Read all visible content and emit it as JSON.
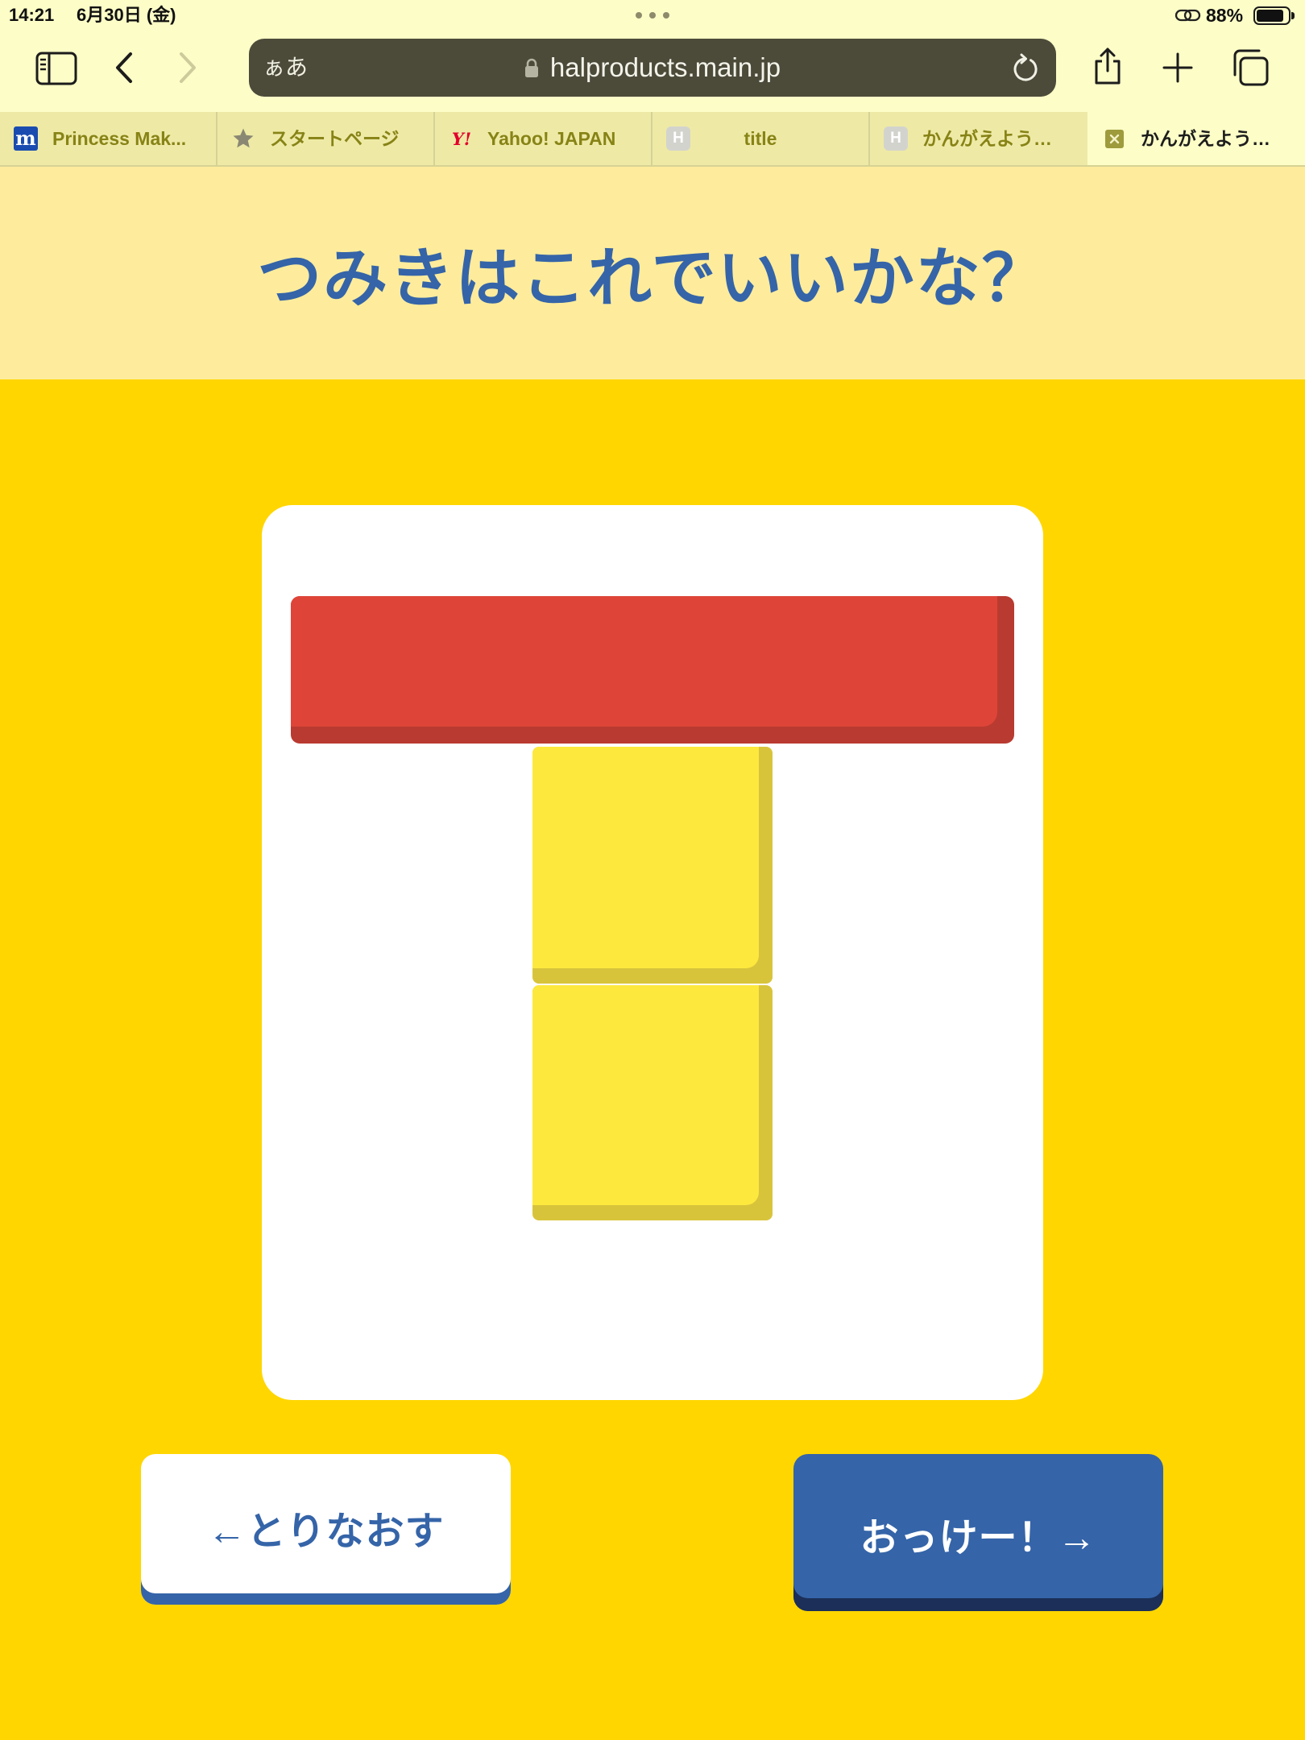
{
  "status_bar": {
    "time": "14:21",
    "date": "6月30日 (金)",
    "battery_text": "88%",
    "battery_level": 0.88
  },
  "toolbar": {
    "text_size_label": "ぁあ",
    "url": "halproducts.main.jp",
    "icons": {
      "sidebar": "sidebar-icon",
      "back": "back-icon",
      "forward": "forward-icon",
      "lock": "lock-icon",
      "reload": "reload-icon",
      "share": "share-icon",
      "new_tab": "plus-icon",
      "tab_overview": "tabs-overview-icon"
    }
  },
  "tabs": [
    {
      "label": "Princess Mak...",
      "favicon_text": "m",
      "icon": "m-favicon-icon",
      "active": false
    },
    {
      "label": "スタートページ",
      "icon": "star-icon",
      "active": false
    },
    {
      "label": "Yahoo! JAPAN",
      "favicon_text": "Y!",
      "icon": "yahoo-favicon-icon",
      "active": false
    },
    {
      "label": "title",
      "favicon_text": "H",
      "icon": "h-favicon-icon",
      "active": false
    },
    {
      "label": "かんがえよう…",
      "favicon_text": "H",
      "icon": "h-favicon-icon",
      "active": false
    },
    {
      "label": "かんがえよう…",
      "icon": "close-tab-icon",
      "active": true
    }
  ],
  "page": {
    "title": "つみきはこれでいいかな？",
    "blocks": [
      {
        "color": "#de4538",
        "shade": "#b93a30"
      },
      {
        "color": "#fde83e",
        "shade": "#d8c43b"
      },
      {
        "color": "#fde83e",
        "shade": "#d8c43b"
      }
    ],
    "buttons": {
      "retry_label": "←とりなおす",
      "ok_label": "おっけー！→"
    }
  },
  "colors": {
    "chrome_bg": "#fdfdc7",
    "tab_inactive_bg": "#eeeaa6",
    "tab_divider": "#d6d295",
    "tab_text": "#878316",
    "url_bar_bg": "#4c4b3a",
    "url_text": "#f3f3ea",
    "header_bg": "#feec9c",
    "page_bg": "#ffd600",
    "title_blue": "#3564a8",
    "button_blue": "#3564a8",
    "button_navy": "#1b2f58",
    "card_bg": "#ffffff"
  }
}
